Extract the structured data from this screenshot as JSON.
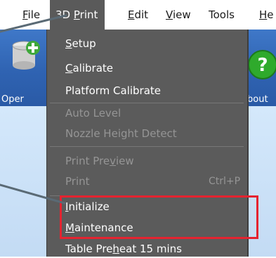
{
  "menubar": {
    "items": [
      {
        "key": "F",
        "rest": "ile"
      },
      {
        "pre": "3D ",
        "key": "P",
        "rest": "rint"
      },
      {
        "key": "E",
        "rest": "dit"
      },
      {
        "key": "V",
        "rest": "iew"
      },
      {
        "pre": "Tools"
      },
      {
        "key": "H",
        "rest": "e"
      }
    ]
  },
  "toolbar": {
    "open_label": "Oper",
    "about_label": "bout",
    "about_glyph": "?"
  },
  "dropdown": {
    "items": [
      {
        "key": "S",
        "rest": "etup"
      },
      {
        "key": "C",
        "rest": "alibrate"
      },
      {
        "pre": "Platform Calibrate"
      },
      {
        "pre": "Auto Level"
      },
      {
        "pre": "Nozzle Height Detect"
      },
      {
        "pre": "Print Pre",
        "key": "v",
        "rest": "iew"
      },
      {
        "pre": "Print",
        "shortcut": "Ctrl+P"
      },
      {
        "key": "I",
        "rest": "nitialize"
      },
      {
        "key": "M",
        "rest": "aintenance"
      },
      {
        "pre": "Table Pre",
        "key": "h",
        "rest": "eat 15 mins"
      }
    ]
  },
  "colors": {
    "highlight": "#e52330",
    "menu_bg": "#5b5b5b",
    "toolbar_bg": "#2f63b2"
  }
}
